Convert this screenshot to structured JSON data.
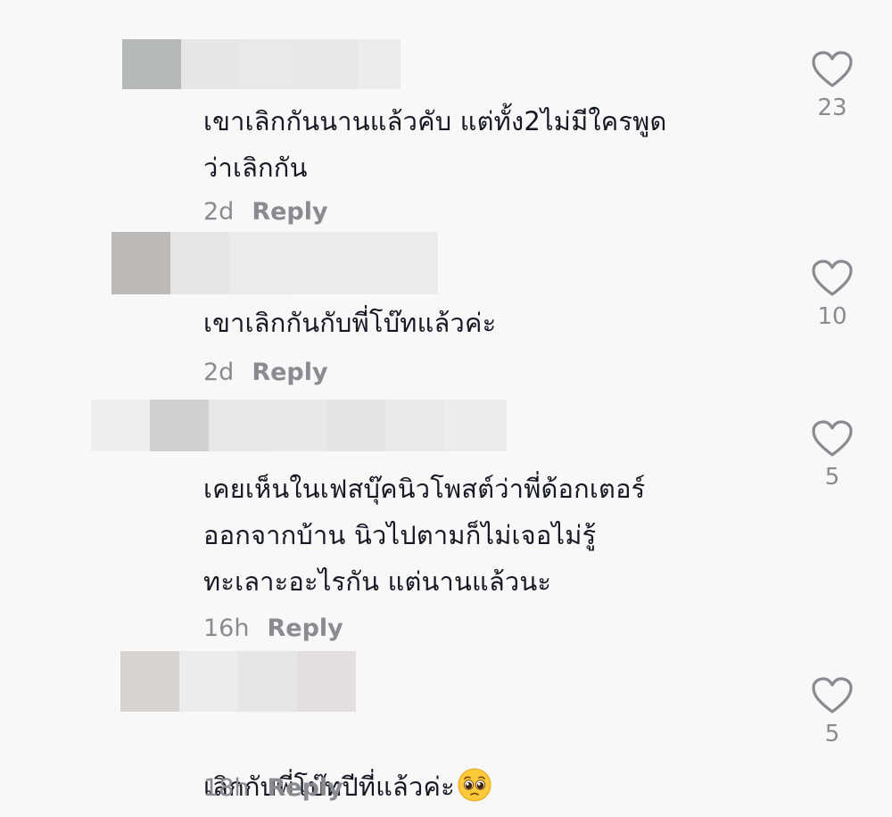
{
  "comments": [
    {
      "text": "เขาเลิกกันนานแล้วคับ แต่ทั้ง2ไม่มีใครพูด\nว่าเลิกกัน",
      "time": "2d",
      "reply_label": "Reply",
      "likes": "23"
    },
    {
      "text": "เขาเลิกกันกับพี่โบ๊ทแล้วค่ะ",
      "time": "2d",
      "reply_label": "Reply",
      "likes": "10"
    },
    {
      "text": "เคยเห็นในเฟสบุ๊คนิวโพสต์ว่าพี่ด้อกเตอร์\nออกจากบ้าน นิวไปตามก็ไม่เจอไม่รู้\nทะเลาะอะไรกัน แต่นานแล้วนะ",
      "time": "16h",
      "reply_label": "Reply",
      "likes": "5"
    },
    {
      "text": "เลิกกับพี่โบ๊ทปีที่แล้วค่ะ",
      "time": "18h",
      "reply_label": "Reply",
      "likes": "5",
      "emoji": "pleading-face-emoji"
    }
  ],
  "icons": {
    "like": "heart-outline-icon"
  },
  "colors": {
    "background": "#f8f8f8",
    "text": "#161823",
    "meta": "#8a8b91",
    "heart_stroke": "#8a8b91"
  }
}
